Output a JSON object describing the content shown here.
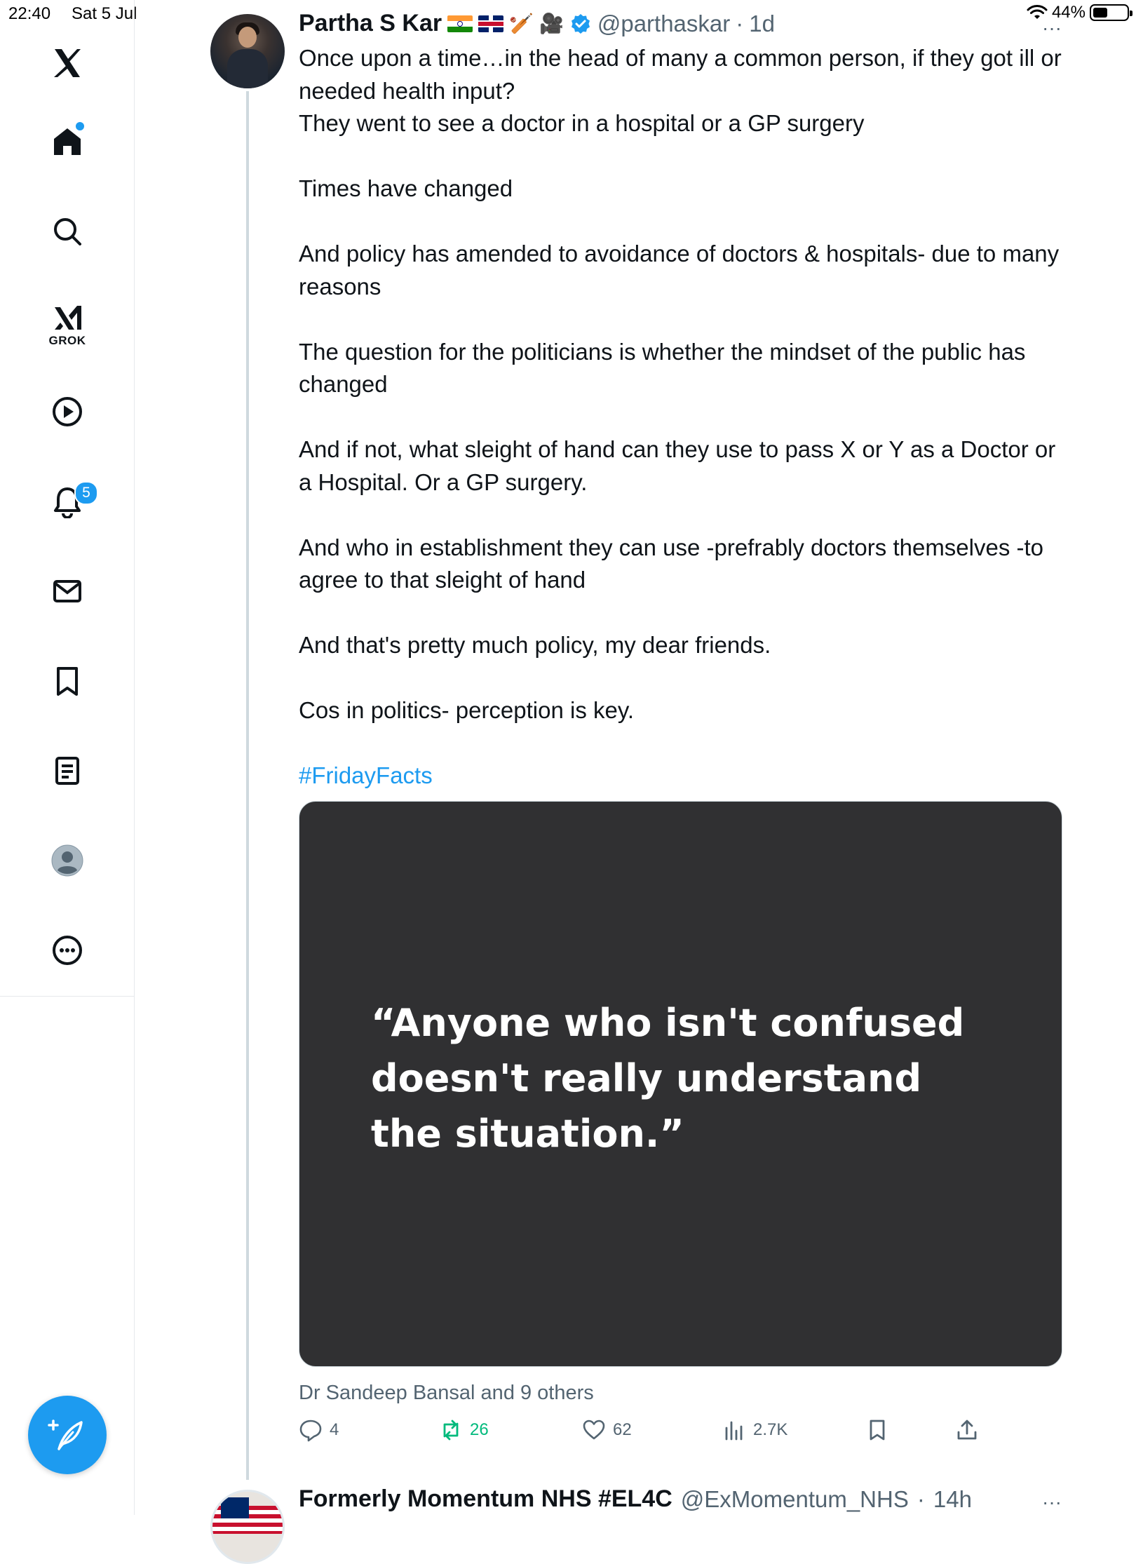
{
  "status_bar": {
    "time": "22:40",
    "date": "Sat 5 Jul",
    "battery": "44%"
  },
  "sidebar": {
    "logo": "x-logo-icon",
    "items": [
      {
        "name": "home",
        "icon": "home-icon",
        "has_dot": true
      },
      {
        "name": "explore",
        "icon": "search-icon"
      },
      {
        "name": "grok",
        "icon": "grok-icon",
        "label": "GROK"
      },
      {
        "name": "video",
        "icon": "play-icon"
      },
      {
        "name": "notifications",
        "icon": "bell-icon",
        "badge": "5"
      },
      {
        "name": "messages",
        "icon": "mail-icon"
      },
      {
        "name": "bookmarks",
        "icon": "bookmark-icon"
      },
      {
        "name": "lists",
        "icon": "list-icon"
      },
      {
        "name": "profile",
        "icon": "profile-icon"
      },
      {
        "name": "more",
        "icon": "more-icon"
      }
    ],
    "compose_icon": "compose-icon"
  },
  "tweet": {
    "display_name": "Partha S Kar",
    "handle": "@parthaskar",
    "separator": "·",
    "time": "1d",
    "more": "···",
    "paragraphs": [
      "Once upon a time…in the head of many a common person, if they got ill or needed health input?",
      "They went to see a doctor in a hospital or a GP surgery",
      "",
      "Times have changed",
      "",
      "And policy has amended to avoidance of doctors & hospitals- due to many reasons",
      "",
      "The question for the politicians is whether the mindset of the public has changed",
      "",
      "And if not, what sleight of hand can they use to pass X or Y as a Doctor or a Hospital. Or a GP surgery.",
      "",
      "And who in establishment they can use -prefrably doctors themselves -to agree to that sleight of hand",
      "",
      "And that's pretty much policy, my dear friends.",
      "",
      "Cos in politics- perception is key.",
      ""
    ],
    "hashtag": "#FridayFacts",
    "media_quote": [
      "“Anyone who isn't confused",
      "doesn't really understand",
      "the situation.”"
    ],
    "liked_by": "Dr Sandeep Bansal and 9 others",
    "actions": {
      "replies": "4",
      "reposts": "26",
      "likes": "62",
      "views": "2.7K"
    },
    "colors": {
      "accent": "#1d9bf0",
      "repost_active": "#00ba7c",
      "muted": "#536471"
    }
  },
  "next_tweet": {
    "display_name": "Formerly Momentum NHS #EL4C",
    "handle": "@ExMomentum_NHS",
    "separator": "·",
    "time": "14h",
    "more": "···"
  }
}
